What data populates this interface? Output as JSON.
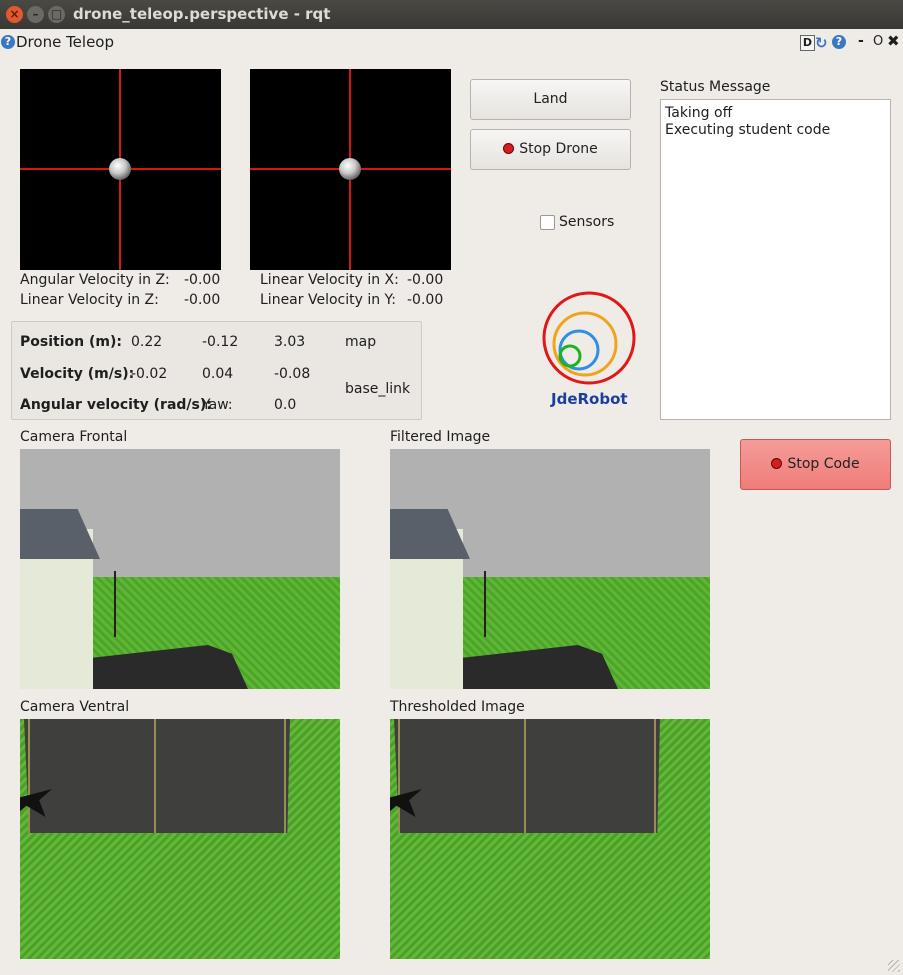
{
  "window": {
    "title": "drone_teleop.perspective - rqt"
  },
  "plugin": {
    "title": "Drone Teleop",
    "help_glyph": "?",
    "d_glyph": "D",
    "dash": "-",
    "o": "O"
  },
  "joystick_left": {
    "angular_z_label": "Angular Velocity in Z:",
    "angular_z_value": "-0.00",
    "linear_z_label": "Linear Velocity in Z:",
    "linear_z_value": "-0.00"
  },
  "joystick_right": {
    "linear_x_label": "Linear Velocity in X:",
    "linear_x_value": "-0.00",
    "linear_y_label": "Linear Velocity in Y:",
    "linear_y_value": "-0.00"
  },
  "controls": {
    "land": "Land",
    "stop_drone": "Stop Drone",
    "sensors": "Sensors",
    "stop_code": "Stop Code"
  },
  "pose": {
    "position_label": "Position (m):",
    "pos_x": "0.22",
    "pos_y": "-0.12",
    "pos_z": "3.03",
    "frame_map": "map",
    "velocity_label": "Velocity (m/s):",
    "vel_x": "-0.02",
    "vel_y": "0.04",
    "vel_z": "-0.08",
    "frame_base": "base_link",
    "angular_label": "Angular velocity (rad/s):",
    "yaw_label": "Yaw:",
    "yaw_value": "0.0"
  },
  "logo": {
    "text": "JdeRobot"
  },
  "status": {
    "label": "Status Message",
    "lines": [
      "Taking off",
      "Executing student code"
    ]
  },
  "cameras": {
    "frontal": "Camera Frontal",
    "filtered": "Filtered Image",
    "ventral": "Camera Ventral",
    "thresholded": "Thresholded Image"
  }
}
